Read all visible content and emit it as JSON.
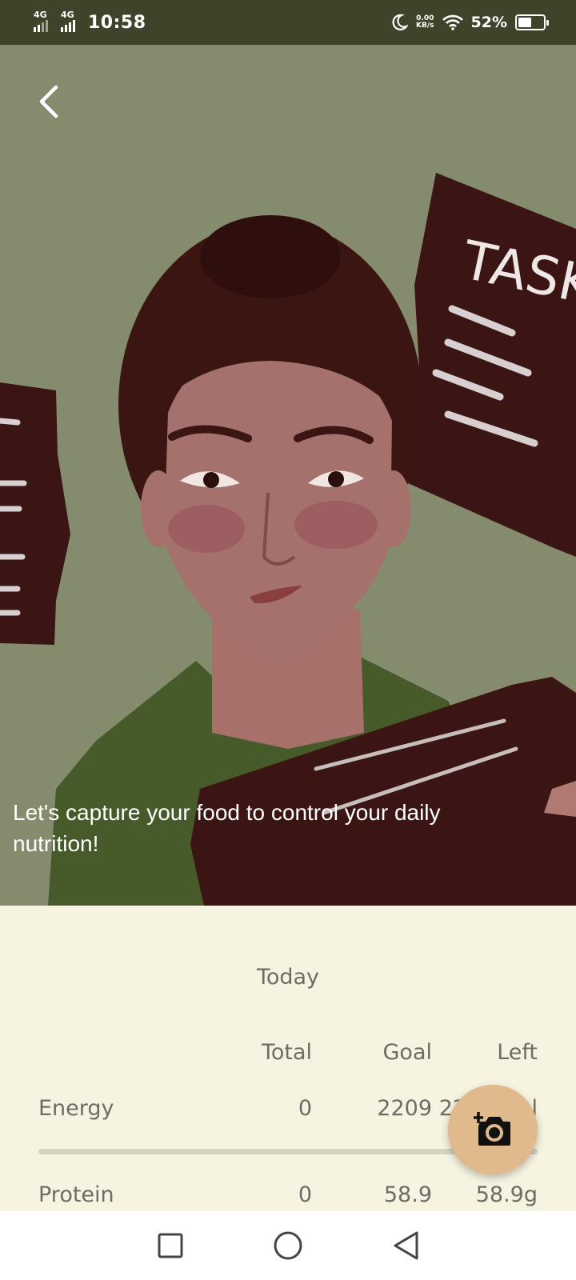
{
  "status_bar": {
    "net1": "4G",
    "net2": "4G",
    "time": "10:58",
    "speed_value": "0.00",
    "speed_unit": "KB/s",
    "battery_text": "52%",
    "battery_level": 0.52,
    "icons": [
      "signal-icon",
      "moon-icon",
      "wifi-icon",
      "battery-icon"
    ]
  },
  "hero": {
    "back_icon": "chevron-left-icon",
    "illustration_text": "TASK",
    "caption": "Let's capture your food to control your daily nutrition!"
  },
  "nutrition": {
    "period": "Today",
    "columns": [
      "Total",
      "Goal",
      "Left"
    ],
    "rows": [
      {
        "label": "Energy",
        "total": "0",
        "goal": "2209",
        "left": "2209kcal"
      },
      {
        "label": "Protein",
        "total": "0",
        "goal": "58.9",
        "left": "58.9g"
      }
    ],
    "energy_progress": 0
  },
  "fab": {
    "icon": "add-photo-camera-icon"
  },
  "nav": {
    "icons": [
      "recents-square-icon",
      "home-circle-icon",
      "back-triangle-icon"
    ]
  },
  "colors": {
    "status_bar": "#3e4329",
    "hero_bg": "#858c6d",
    "panel_bg": "#f7f3e1",
    "fab": "#e0b98d",
    "text": "#6d6d66"
  }
}
